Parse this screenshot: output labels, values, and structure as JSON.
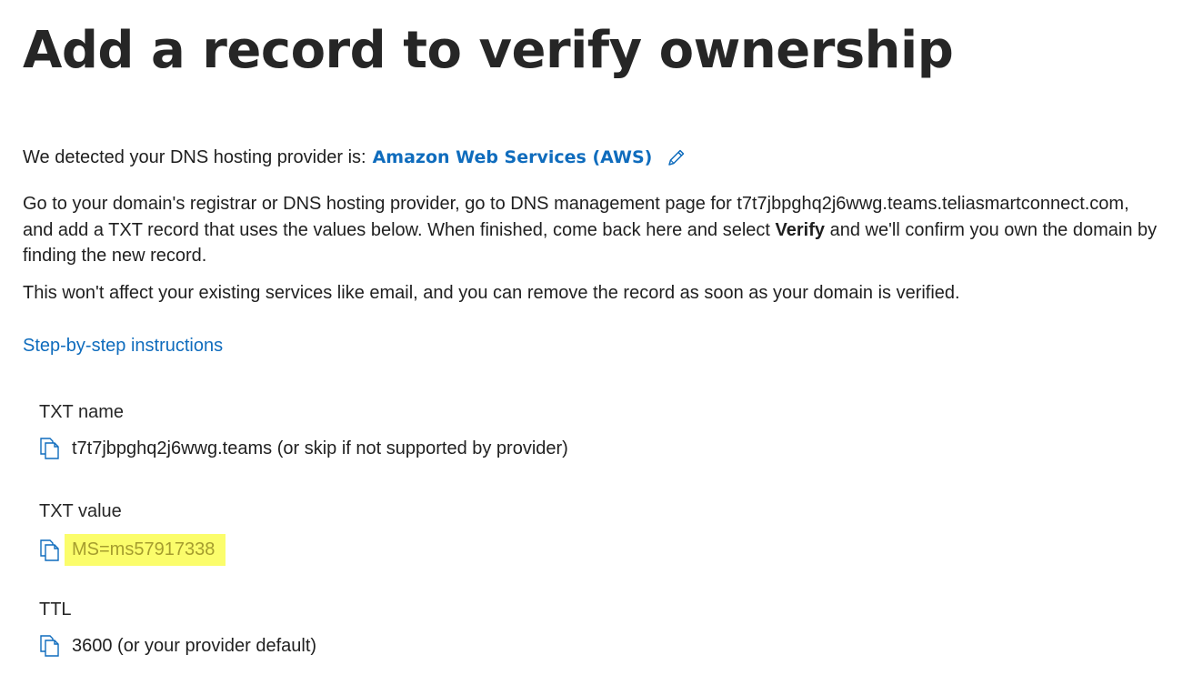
{
  "page": {
    "title": "Add a record to verify ownership"
  },
  "dns": {
    "detected_prefix": "We detected your DNS hosting provider is:",
    "provider_name": "Amazon Web Services (AWS)",
    "edit_icon": "pencil-edit-icon"
  },
  "instructions": {
    "para1_part1": "Go to your domain's registrar or DNS hosting provider, go to DNS management page for t7t7jbpghq2j6wwg.teams.teliasmartconnect.com, and add a TXT record that uses the values below. When finished, come back here and select ",
    "para1_bold": "Verify",
    "para1_part2": " and we'll confirm you own the domain by finding the new record.",
    "para2": "This won't affect your existing services like email, and you can remove the record as soon as your domain is verified.",
    "step_link": "Step-by-step instructions"
  },
  "records": {
    "txt_name_label": "TXT name",
    "txt_name_value": "t7t7jbpghq2j6wwg.teams (or skip if not supported by provider)",
    "txt_value_label": "TXT value",
    "txt_value_value": "MS=ms57917338",
    "ttl_label": "TTL",
    "ttl_value": "3600 (or your provider default)",
    "copy_icon": "copy-icon",
    "highlight_color": "#fbfd6b",
    "link_color": "#0f6cbd"
  }
}
